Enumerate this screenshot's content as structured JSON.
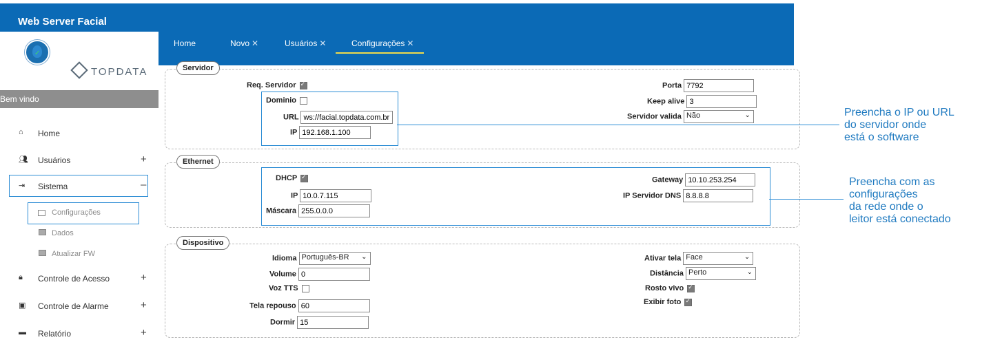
{
  "app": {
    "title": "Web Server Facial"
  },
  "sidebar": {
    "brand": "TOPDATA",
    "welcome": "Bem vindo",
    "items": [
      {
        "label": "Home",
        "icon": "home-icon"
      },
      {
        "label": "Usuários",
        "toggle": "+",
        "icon": "users-icon"
      },
      {
        "label": "Sistema",
        "toggle": "–",
        "icon": "login-icon"
      },
      {
        "label": "Controle de Acesso",
        "toggle": "+",
        "icon": "lock-icon"
      },
      {
        "label": "Controle de Alarme",
        "toggle": "+",
        "icon": "calendar-icon"
      },
      {
        "label": "Relatório",
        "toggle": "+",
        "icon": "report-icon"
      }
    ],
    "sub_items": [
      {
        "label": "Configurações"
      },
      {
        "label": "Dados"
      },
      {
        "label": "Atualizar FW"
      }
    ]
  },
  "tabs": [
    {
      "label": "Home",
      "closable": false
    },
    {
      "label": "Novo",
      "closable": true
    },
    {
      "label": "Usuários",
      "closable": true
    },
    {
      "label": "Configurações",
      "closable": true,
      "active": true
    }
  ],
  "tab_close_glyph": "✕",
  "servidor": {
    "legend": "Servidor",
    "req_servidor_label": "Req. Servidor",
    "req_servidor": true,
    "dominio_label": "Dominio",
    "dominio": false,
    "url_label": "URL",
    "url": "ws://facial.topdata.com.br",
    "ip_label": "IP",
    "ip": "192.168.1.100",
    "porta_label": "Porta",
    "porta": "7792",
    "keep_alive_label": "Keep alive",
    "keep_alive": "3",
    "servidor_valida_label": "Servidor valida",
    "servidor_valida": "Não"
  },
  "ethernet": {
    "legend": "Ethernet",
    "dhcp_label": "DHCP",
    "dhcp": true,
    "ip_label": "IP",
    "ip": "10.0.7.115",
    "mascara_label": "Máscara",
    "mascara": "255.0.0.0",
    "gateway_label": "Gateway",
    "gateway": "10.10.253.254",
    "dns_label": "IP Servidor DNS",
    "dns": "8.8.8.8"
  },
  "dispositivo": {
    "legend": "Dispositivo",
    "idioma_label": "Idioma",
    "idioma": "Português-BR",
    "volume_label": "Volume",
    "volume": "0",
    "voz_tts_label": "Voz TTS",
    "voz_tts": false,
    "tela_repouso_label": "Tela repouso",
    "tela_repouso": "60",
    "dormir_label": "Dormir",
    "dormir": "15",
    "ativar_tela_label": "Ativar tela",
    "ativar_tela": "Face",
    "distancia_label": "Distância",
    "distancia": "Perto",
    "rosto_vivo_label": "Rosto vivo",
    "rosto_vivo": true,
    "exibir_foto_label": "Exibir foto",
    "exibir_foto": true
  },
  "callouts": {
    "server": [
      "Preencha o IP ou URL",
      "do servidor onde",
      "está o software"
    ],
    "network": [
      "Preencha com as",
      "configurações",
      "da rede onde o",
      "leitor está conectado"
    ]
  },
  "colors": {
    "header": "#0b6ab6",
    "accent": "#2a8bd4",
    "active_tab_underline": "#f2dc4a",
    "callout_text": "#1f7ac0"
  }
}
